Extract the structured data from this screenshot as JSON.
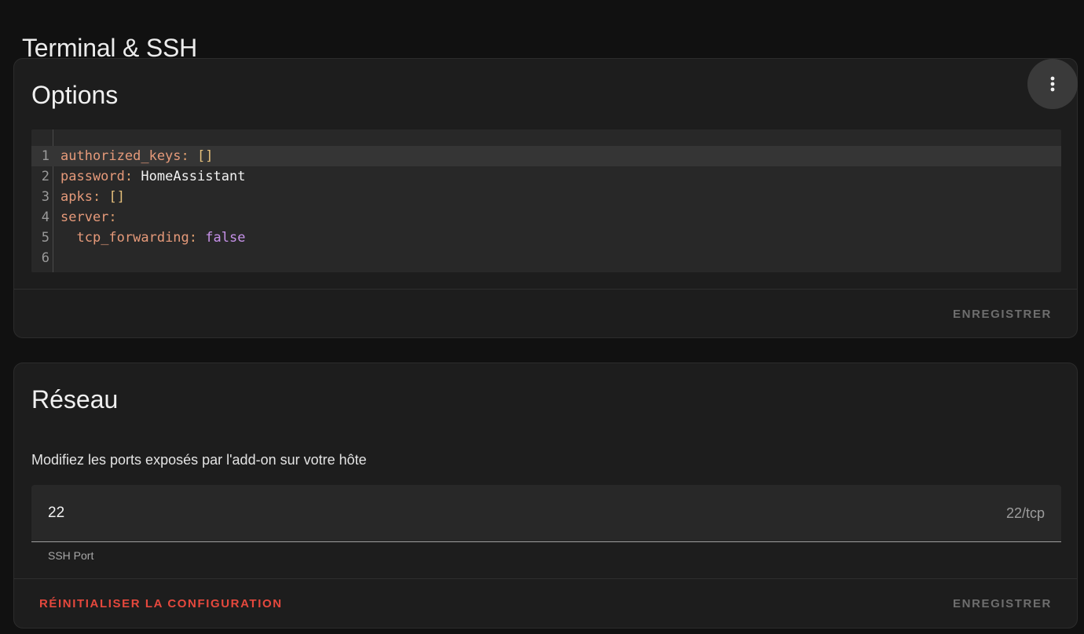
{
  "page": {
    "title": "Terminal & SSH"
  },
  "options_card": {
    "heading": "Options",
    "menu_icon": "dots-vertical-icon",
    "editor": {
      "lines": [
        {
          "no": "1",
          "key": "authorized_keys",
          "sep": ":",
          "value": "[]",
          "value_type": "bracket",
          "indent": ""
        },
        {
          "no": "2",
          "key": "password",
          "sep": ":",
          "value": "HomeAssistant",
          "value_type": "str",
          "indent": ""
        },
        {
          "no": "3",
          "key": "apks",
          "sep": ":",
          "value": "[]",
          "value_type": "bracket",
          "indent": ""
        },
        {
          "no": "4",
          "key": "server",
          "sep": ":",
          "value": "",
          "value_type": "str",
          "indent": ""
        },
        {
          "no": "5",
          "key": "tcp_forwarding",
          "sep": ":",
          "value": "false",
          "value_type": "bool",
          "indent": "  "
        },
        {
          "no": "6",
          "key": "",
          "sep": "",
          "value": "",
          "value_type": "str",
          "indent": ""
        }
      ],
      "active_line": 1
    },
    "save_label": "ENREGISTRER"
  },
  "network_card": {
    "heading": "Réseau",
    "description": "Modifiez les ports exposés par l'add-on sur votre hôte",
    "port": {
      "value": "22",
      "suffix": "22/tcp",
      "helper": "SSH Port"
    },
    "reset_label": "RÉINITIALISER LA CONFIGURATION",
    "save_label": "ENREGISTRER"
  },
  "colors": {
    "background": "#111111",
    "card": "#1d1d1d",
    "editor": "#282828",
    "yaml_key": "#e69a7a",
    "yaml_bracket": "#e6c07b",
    "yaml_bool": "#c792ea",
    "reset_accent": "#e5483d",
    "disabled_text": "#6e6e6e"
  }
}
